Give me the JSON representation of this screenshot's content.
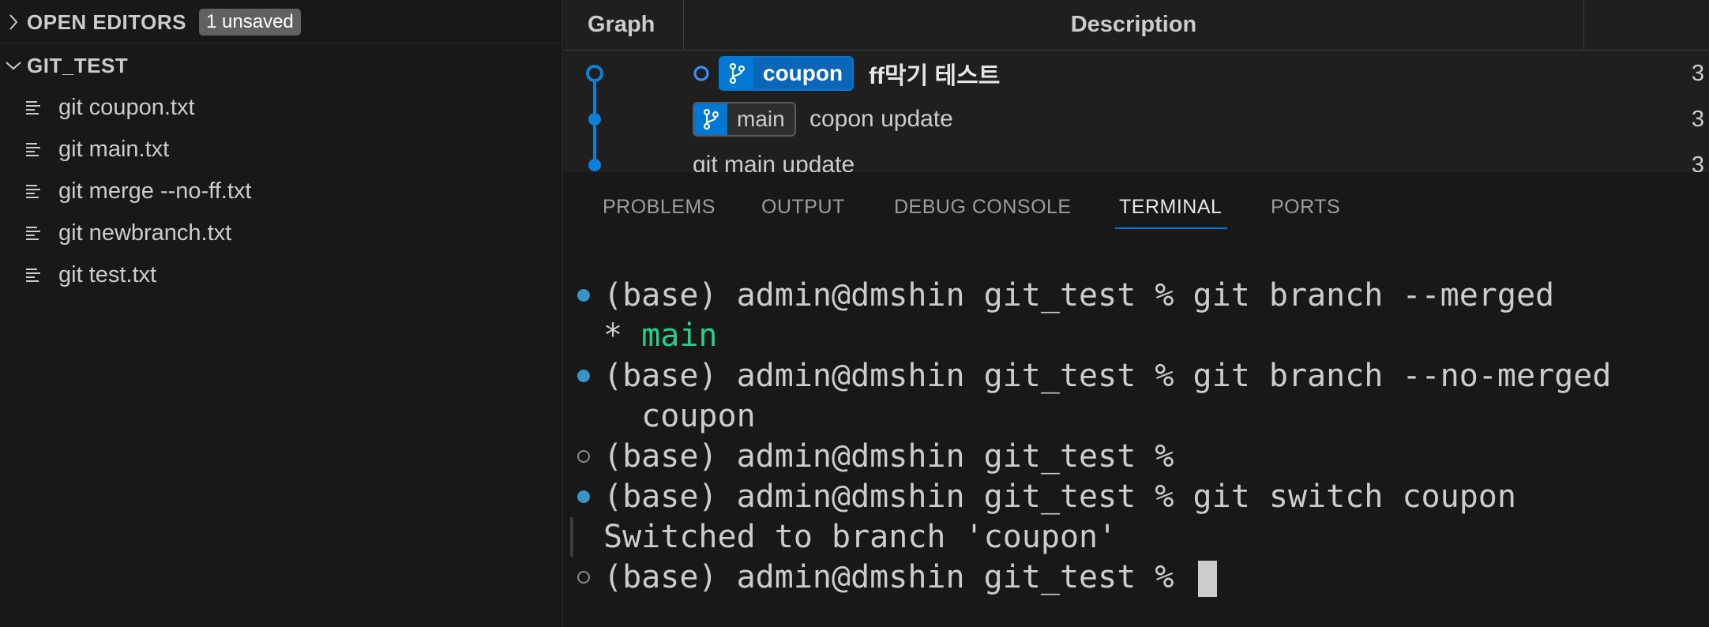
{
  "explorer": {
    "open_editors": {
      "title": "OPEN EDITORS",
      "badge": "1 unsaved"
    },
    "folder": {
      "title": "GIT_TEST"
    },
    "files": [
      {
        "name": "git coupon.txt"
      },
      {
        "name": "git main.txt"
      },
      {
        "name": "git merge --no-ff.txt"
      },
      {
        "name": "git newbranch.txt"
      },
      {
        "name": "git test.txt"
      }
    ]
  },
  "graph": {
    "col_graph": "Graph",
    "col_description": "Description",
    "rows": [
      {
        "branch": "coupon",
        "message": "ff막기 테스트",
        "count": "3"
      },
      {
        "branch": "main",
        "message": "copon update",
        "count": "3"
      },
      {
        "message": "git main update",
        "count": "3"
      }
    ]
  },
  "panel": {
    "tabs": [
      "PROBLEMS",
      "OUTPUT",
      "DEBUG CONSOLE",
      "TERMINAL",
      "PORTS"
    ],
    "active_tab": "TERMINAL"
  },
  "terminal": {
    "lines": [
      {
        "status": "success",
        "text": "(base) admin@dmshin git_test % git branch --merged"
      },
      {
        "status": "none",
        "prefix": "* ",
        "highlight": "main"
      },
      {
        "status": "success",
        "text": "(base) admin@dmshin git_test % git branch --no-merged"
      },
      {
        "status": "none",
        "text": "  coupon"
      },
      {
        "status": "empty",
        "text": "(base) admin@dmshin git_test % "
      },
      {
        "status": "success",
        "text": "(base) admin@dmshin git_test % git switch coupon"
      },
      {
        "status": "none",
        "text": "Switched to branch 'coupon'"
      },
      {
        "status": "empty",
        "text": "(base) admin@dmshin git_test % "
      }
    ]
  },
  "colors": {
    "accent": "#0078d4",
    "success_dot": "#3794c4",
    "branch_highlight": "#23d18b"
  }
}
